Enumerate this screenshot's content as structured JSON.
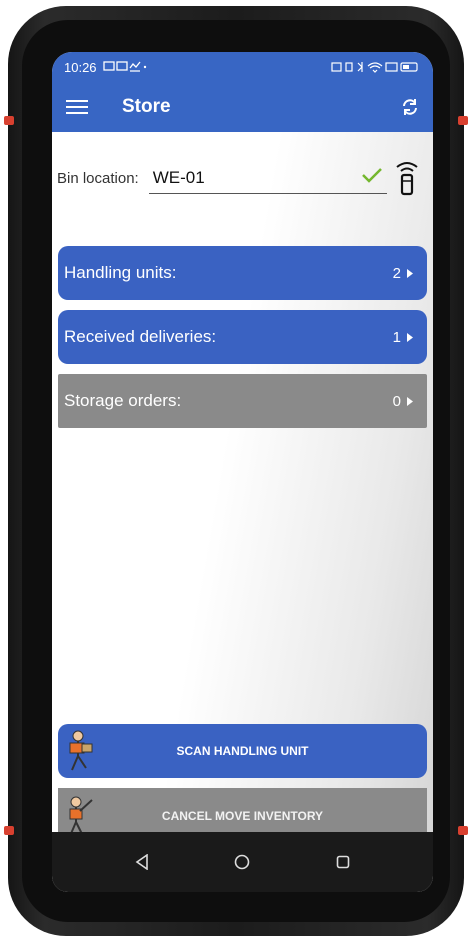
{
  "status_bar": {
    "time": "10:26"
  },
  "app_bar": {
    "title": "Store"
  },
  "bin": {
    "label": "Bin location:",
    "value": "WE-01"
  },
  "tiles": [
    {
      "label": "Handling units:",
      "count": "2",
      "style": "blue"
    },
    {
      "label": "Received deliveries:",
      "count": "1",
      "style": "blue"
    },
    {
      "label": "Storage orders:",
      "count": "0",
      "style": "gray"
    }
  ],
  "actions": {
    "scan_label": "SCAN HANDLING UNIT",
    "cancel_label": "CANCEL MOVE INVENTORY"
  },
  "icons": {
    "menu": "hamburger-menu-icon",
    "refresh": "refresh-icon",
    "check": "check-icon",
    "scanner": "scanner-icon",
    "back": "back-triangle-icon",
    "home": "home-circle-icon",
    "recents": "recents-square-icon"
  },
  "colors": {
    "primary": "#3866c4",
    "tile_blue": "#3a62c2",
    "tile_gray": "#8a8a8a",
    "check": "#74b72e"
  }
}
